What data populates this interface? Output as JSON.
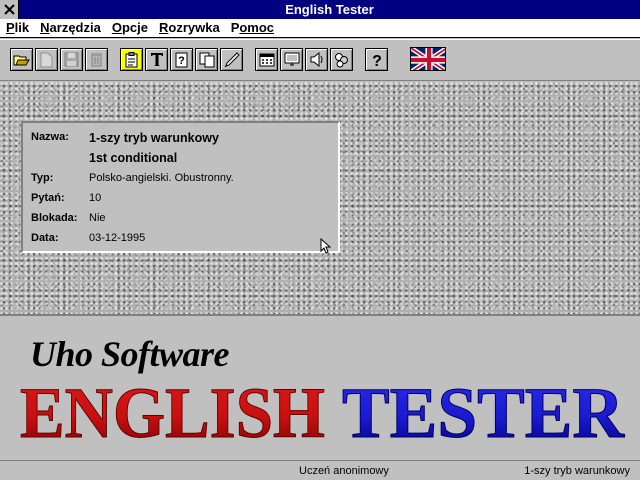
{
  "window": {
    "title": "English Tester"
  },
  "menu": [
    {
      "label": "Plik",
      "accel": "P",
      "rest": "lik"
    },
    {
      "label": "Narzędzia",
      "accel": "N",
      "rest": "arzędzia"
    },
    {
      "label": "Opcje",
      "accel": "O",
      "rest": "pcje"
    },
    {
      "label": "Rozrywka",
      "accel": "R",
      "rest": "ozrywka"
    },
    {
      "label": "Pomoc",
      "accel": "P",
      "rest": "omoc"
    }
  ],
  "toolbar": {
    "buttons": [
      "open-icon",
      "new-icon",
      "save-icon",
      "delete-icon",
      "clipboard-icon",
      "text-icon",
      "question-page-icon",
      "copy-icon",
      "pen-icon",
      "calculator-icon",
      "monitor-icon",
      "speaker-icon",
      "people-icon",
      "help-icon"
    ],
    "active": "clipboard-icon",
    "language_flag": "uk-flag-icon"
  },
  "info": {
    "rows": [
      {
        "label": "Nazwa:",
        "value": "1-szy tryb warunkowy"
      },
      {
        "label": "",
        "value": "1st conditional"
      },
      {
        "label": "Typ:",
        "value": "Polsko-angielski. Obustronny."
      },
      {
        "label": "Pytań:",
        "value": "10"
      },
      {
        "label": "Blokada:",
        "value": "Nie"
      },
      {
        "label": "Data:",
        "value": "03-12-1995"
      }
    ]
  },
  "branding": {
    "company": "Uho Software",
    "logo_word1": "ENGLISH",
    "logo_word2": "TESTER",
    "colors": {
      "english": "#cc1010",
      "tester": "#1a1ad0"
    }
  },
  "status": {
    "user": "Uczeń anonimowy",
    "test": "1-szy tryb warunkowy"
  }
}
